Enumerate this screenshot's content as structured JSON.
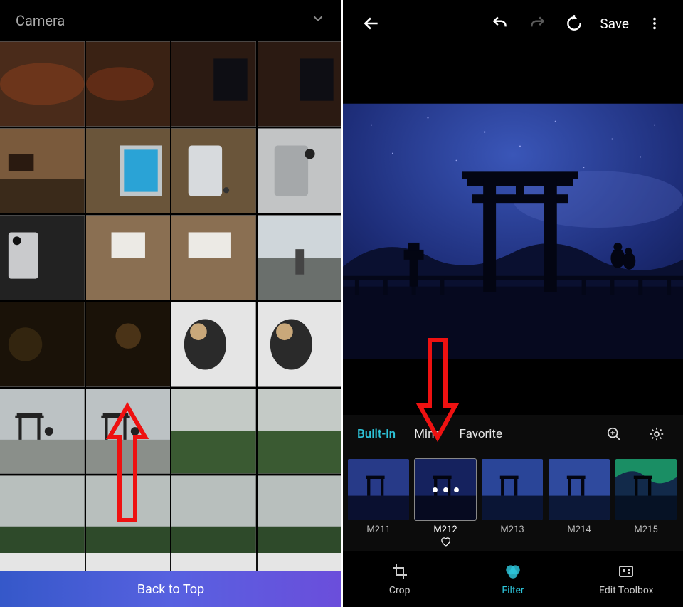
{
  "left": {
    "albumName": "Camera",
    "backToTop": "Back to Top"
  },
  "right": {
    "save": "Save",
    "categories": {
      "builtIn": "Built-in",
      "mine": "Mine",
      "favorite": "Favorite"
    },
    "filters": [
      {
        "label": "M211",
        "selected": false
      },
      {
        "label": "M212",
        "selected": true
      },
      {
        "label": "M213",
        "selected": false
      },
      {
        "label": "M214",
        "selected": false
      },
      {
        "label": "M215",
        "selected": false
      }
    ],
    "bottom": {
      "crop": "Crop",
      "filter": "Filter",
      "toolbox": "Edit Toolbox"
    }
  }
}
